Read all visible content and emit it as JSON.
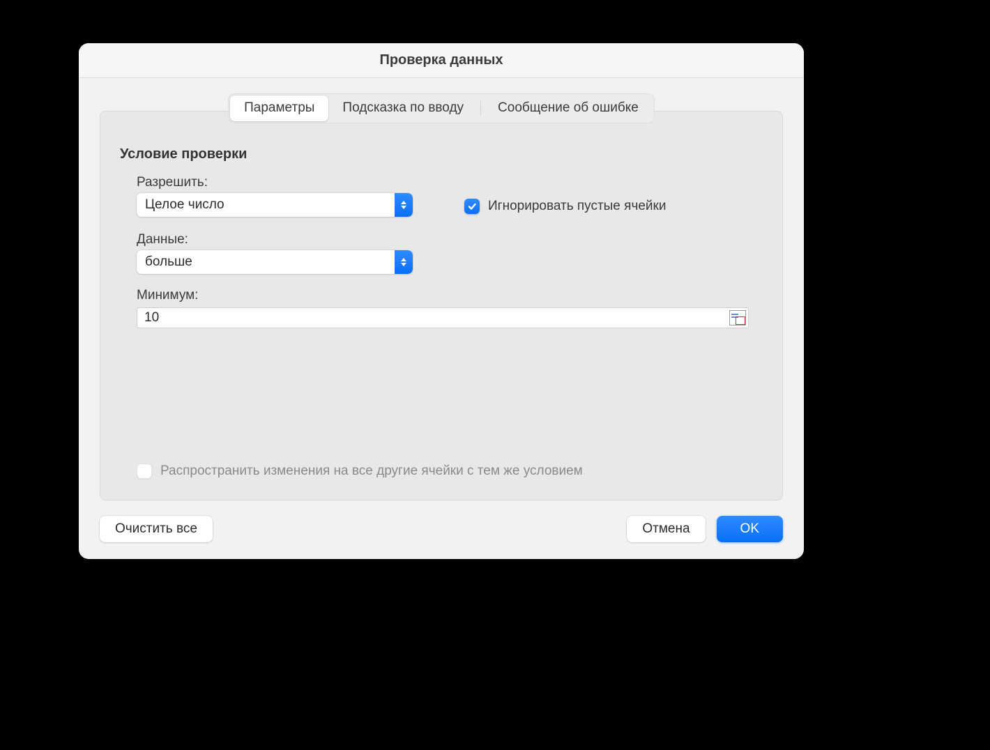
{
  "window": {
    "title": "Проверка данных"
  },
  "tabs": {
    "parameters": "Параметры",
    "input_hint": "Подсказка по вводу",
    "error_message": "Сообщение об ошибке"
  },
  "section": {
    "title": "Условие проверки"
  },
  "fields": {
    "allow_label": "Разрешить:",
    "allow_value": "Целое число",
    "data_label": "Данные:",
    "data_value": "больше",
    "minimum_label": "Минимум:",
    "minimum_value": "10"
  },
  "checkboxes": {
    "ignore_blank": {
      "label": "Игнорировать пустые ячейки",
      "checked": true
    },
    "propagate": {
      "label": "Распространить изменения на все другие ячейки с тем же условием",
      "checked": false,
      "disabled": true
    }
  },
  "buttons": {
    "clear_all": "Очистить все",
    "cancel": "Отмена",
    "ok": "OK"
  }
}
